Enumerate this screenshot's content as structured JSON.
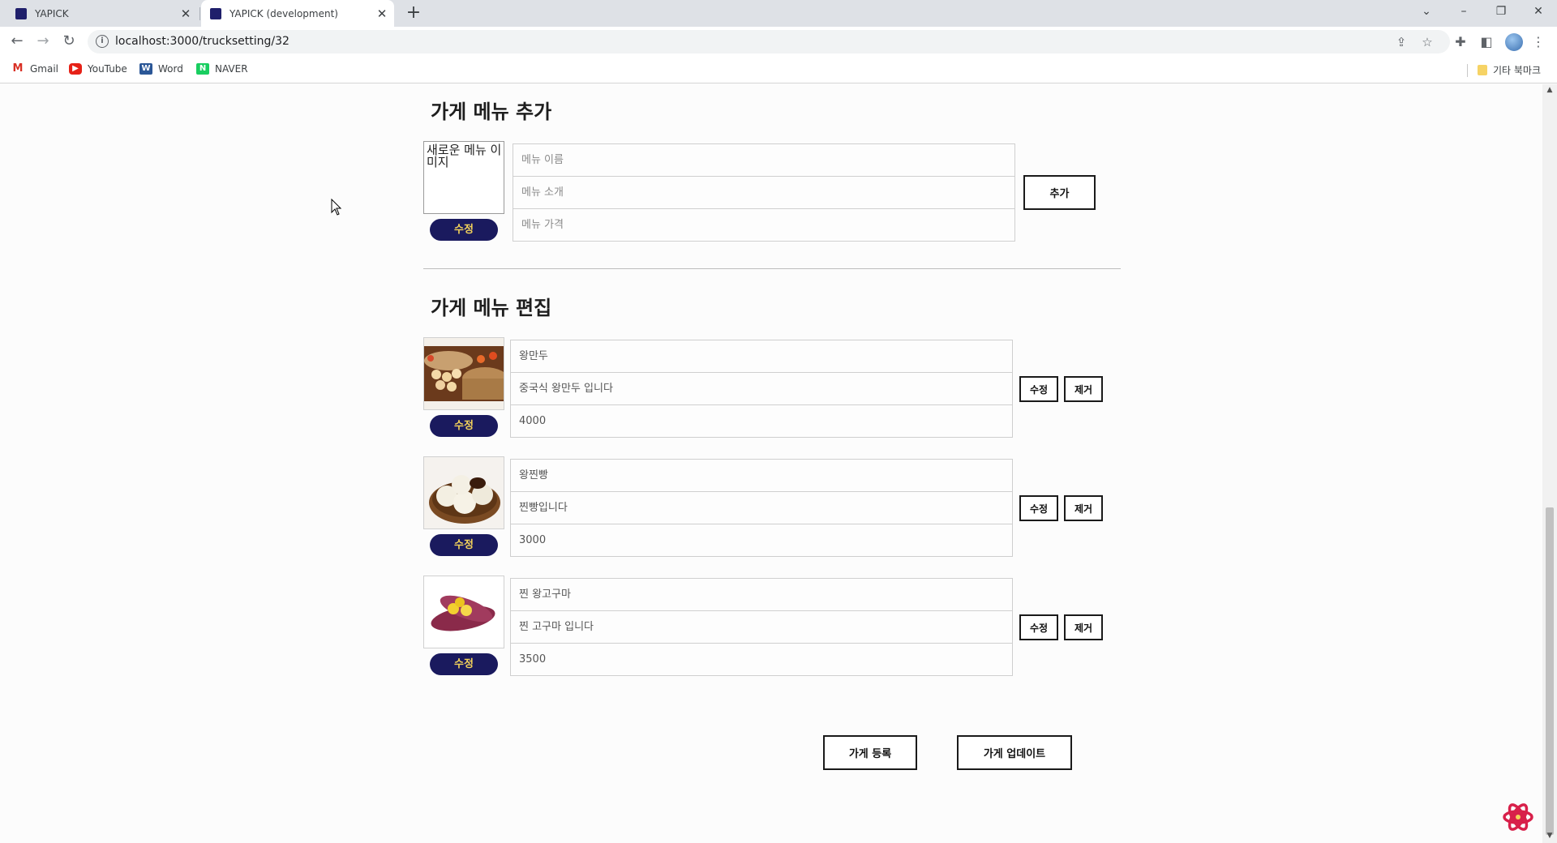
{
  "browser": {
    "tabs": [
      {
        "title": "YAPICK",
        "active": false
      },
      {
        "title": "YAPICK (development)",
        "active": true
      }
    ],
    "url": "localhost:3000/trucksetting/32",
    "bookmarks": [
      {
        "label": "Gmail",
        "icon": "gmail-icon"
      },
      {
        "label": "YouTube",
        "icon": "youtube-icon"
      },
      {
        "label": "Word",
        "icon": "word-icon"
      },
      {
        "label": "NAVER",
        "icon": "naver-icon"
      }
    ],
    "other_bookmarks": "기타 북마크"
  },
  "add_section": {
    "title": "가게 메뉴 추가",
    "image_alt": "새로운 메뉴 이미지",
    "edit_image_label": "수정",
    "name_placeholder": "메뉴 이름",
    "desc_placeholder": "메뉴 소개",
    "price_placeholder": "메뉴 가격",
    "add_label": "추가"
  },
  "edit_section": {
    "title": "가게 메뉴 편집",
    "items": [
      {
        "name": "왕만두",
        "desc": "중국식 왕만두 입니다",
        "price": "4000",
        "image": "dumpling-steamer-photo",
        "edit_image_label": "수정",
        "edit_label": "수정",
        "remove_label": "제거"
      },
      {
        "name": "왕찐빵",
        "desc": "찐빵입니다",
        "price": "3000",
        "image": "steamed-bun-photo",
        "edit_image_label": "수정",
        "edit_label": "수정",
        "remove_label": "제거"
      },
      {
        "name": "찐 왕고구마",
        "desc": "찐 고구마 입니다",
        "price": "3500",
        "image": "sweet-potato-photo",
        "edit_image_label": "수정",
        "edit_label": "수정",
        "remove_label": "제거"
      }
    ]
  },
  "footer": {
    "register_label": "가게 등록",
    "update_label": "가게 업데이트"
  },
  "colors": {
    "pill_bg": "#1a1a5e",
    "pill_text": "#f3d25a",
    "page_bg": "#fcfcfc"
  }
}
